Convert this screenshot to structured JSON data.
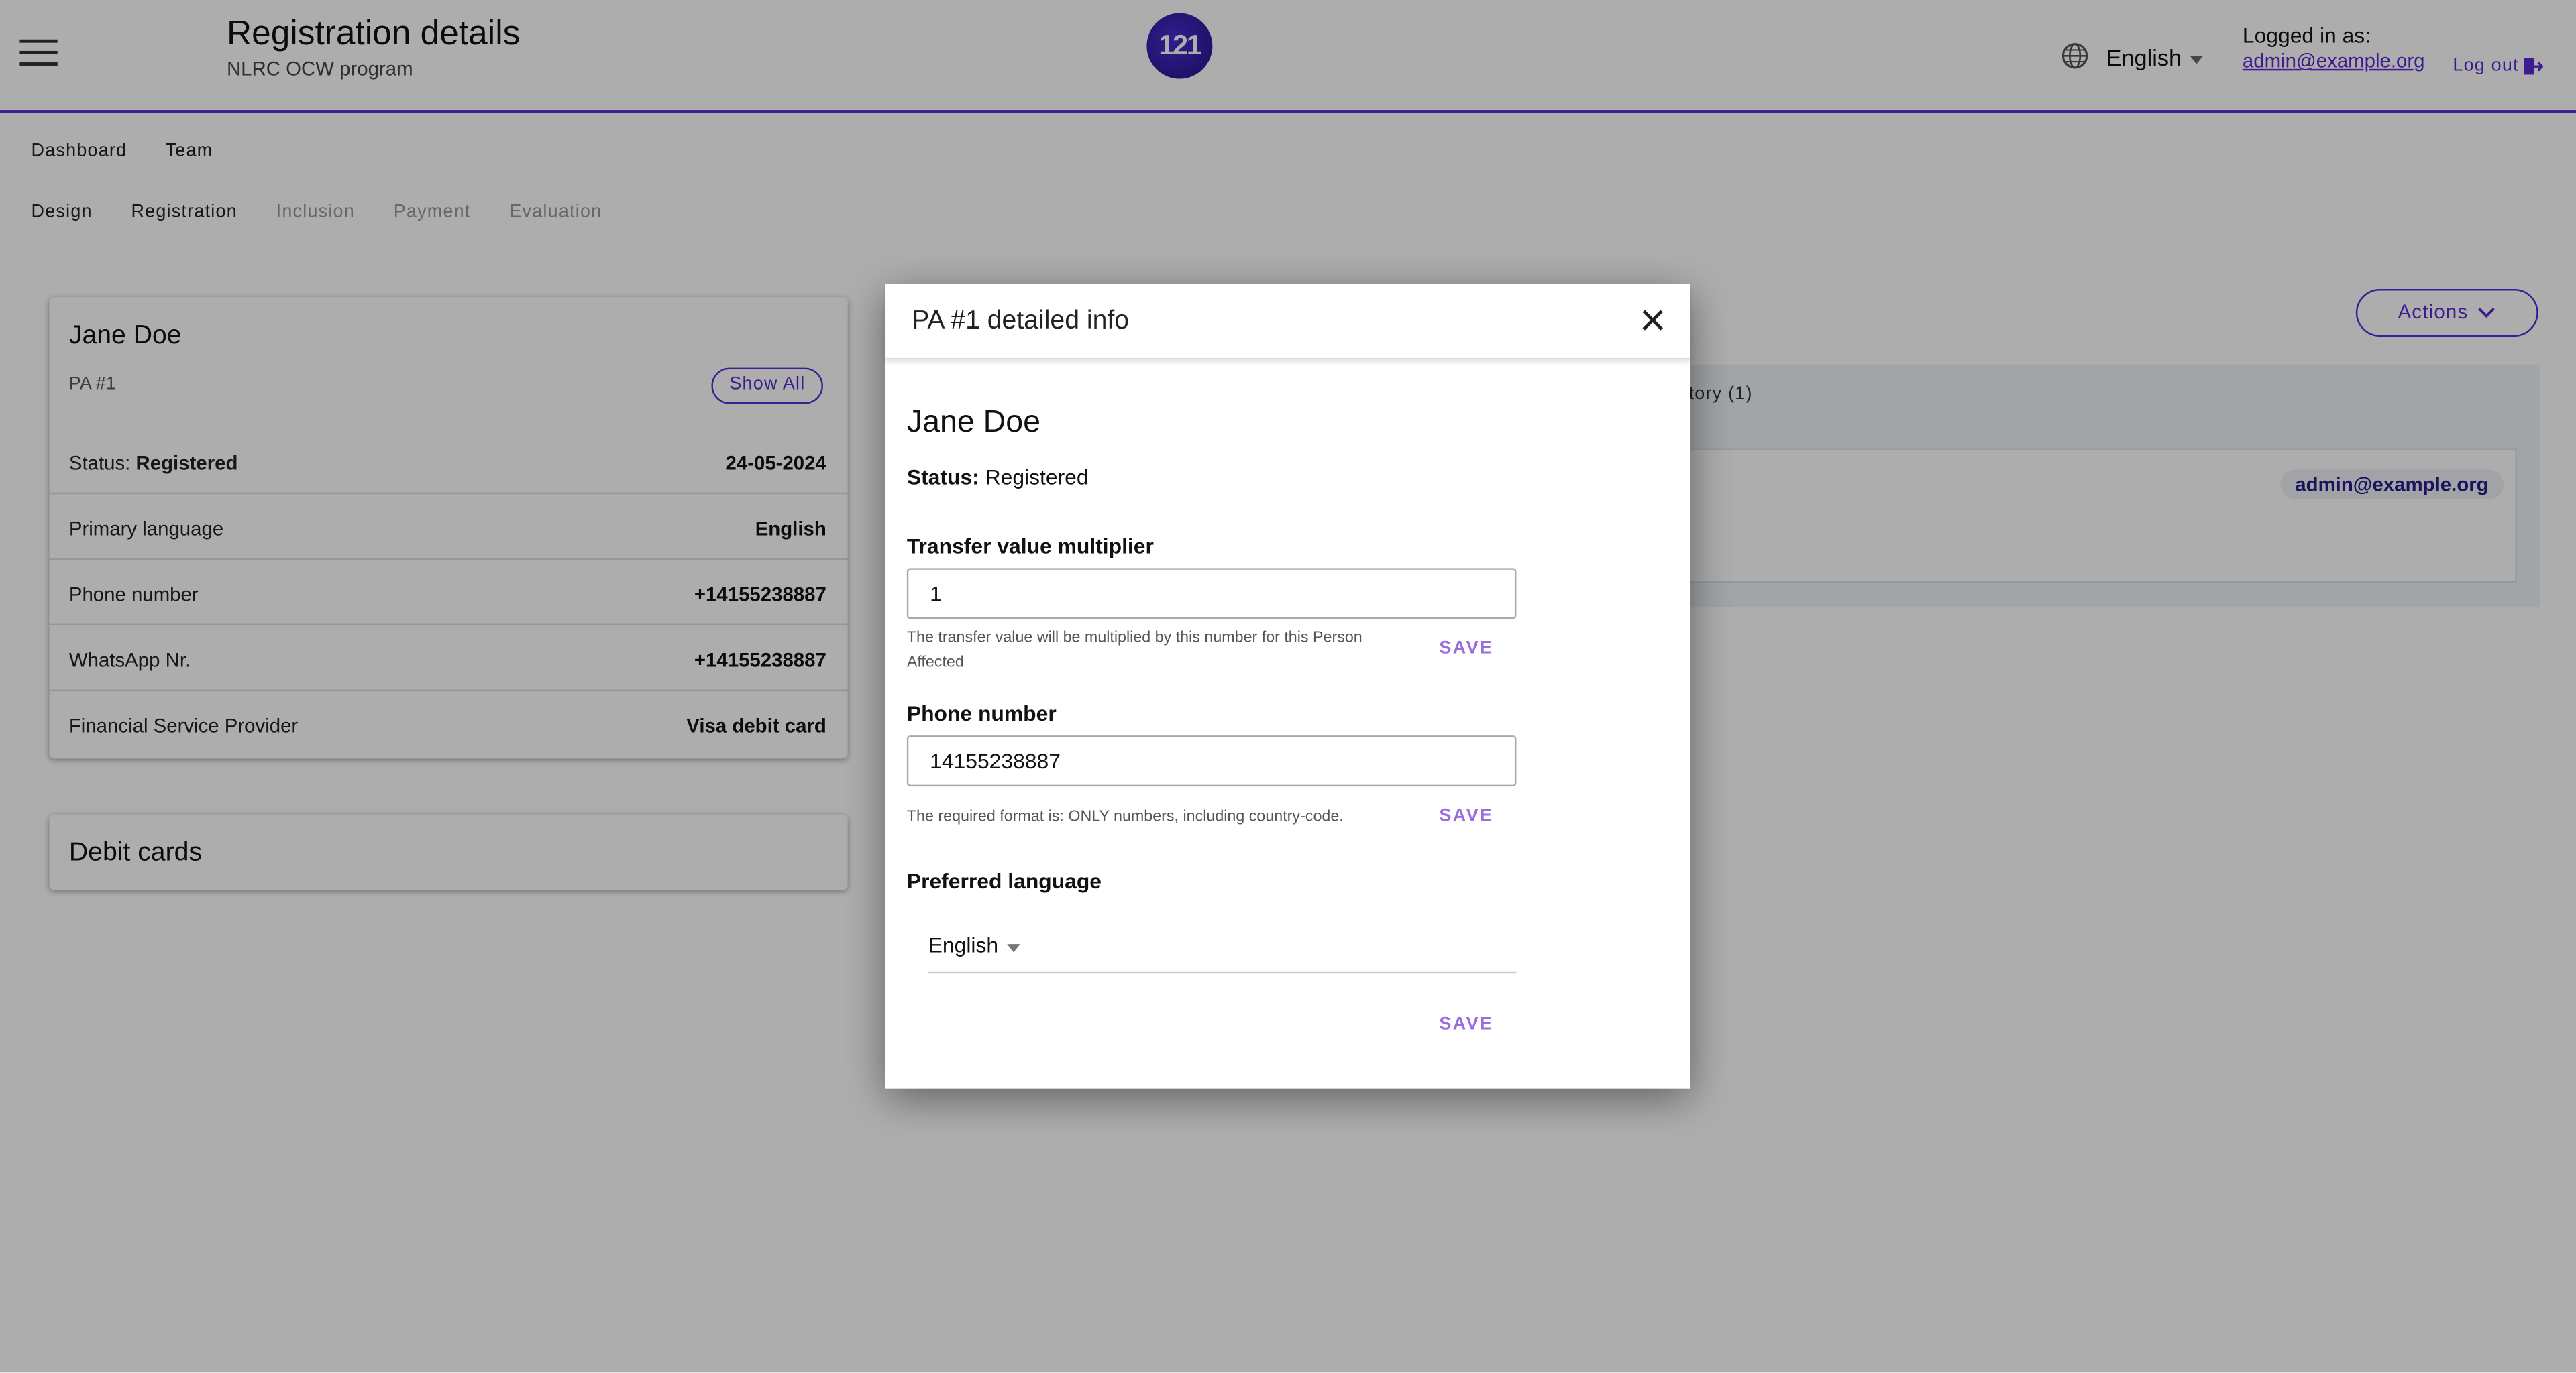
{
  "header": {
    "title": "Registration details",
    "subtitle": "NLRC OCW program",
    "logo_text": "121",
    "language": "English",
    "logged_in_label": "Logged in as:",
    "logged_in_email": "admin@example.org",
    "logout_label": "Log out"
  },
  "nav": {
    "top": [
      "Dashboard",
      "Team"
    ],
    "phases": [
      {
        "label": "Design",
        "active": true
      },
      {
        "label": "Registration",
        "active": true
      },
      {
        "label": "Inclusion",
        "active": false
      },
      {
        "label": "Payment",
        "active": false
      },
      {
        "label": "Evaluation",
        "active": false
      }
    ]
  },
  "person_card": {
    "name": "Jane Doe",
    "pa_id": "PA #1",
    "show_all_label": "Show All",
    "status_label": "Status:",
    "status_value": "Registered",
    "status_date": "24-05-2024",
    "rows": [
      {
        "label": "Primary language",
        "value": "English"
      },
      {
        "label": "Phone number",
        "value": "+14155238887"
      },
      {
        "label": "WhatsApp Nr.",
        "value": "+14155238887"
      },
      {
        "label": "Financial Service Provider",
        "value": "Visa debit card"
      }
    ]
  },
  "debit_cards": {
    "title": "Debit cards"
  },
  "actions": {
    "label": "Actions"
  },
  "history": {
    "tab_label": "tory (1)",
    "email": "admin@example.org"
  },
  "modal": {
    "title": "PA #1 detailed info",
    "name": "Jane Doe",
    "status_label": "Status:",
    "status_value": "Registered",
    "transfer": {
      "label": "Transfer value multiplier",
      "value": "1",
      "helper": "The transfer value will be multiplied by this number for this Person Affected",
      "save_label": "SAVE"
    },
    "phone": {
      "label": "Phone number",
      "value": "14155238887",
      "helper": "The required format is: ONLY numbers, including country-code.",
      "save_label": "SAVE"
    },
    "language": {
      "label": "Preferred language",
      "value": "English",
      "save_label": "SAVE"
    }
  },
  "colors": {
    "accent": "#5a2ad6",
    "save": "#9a6ce0"
  }
}
